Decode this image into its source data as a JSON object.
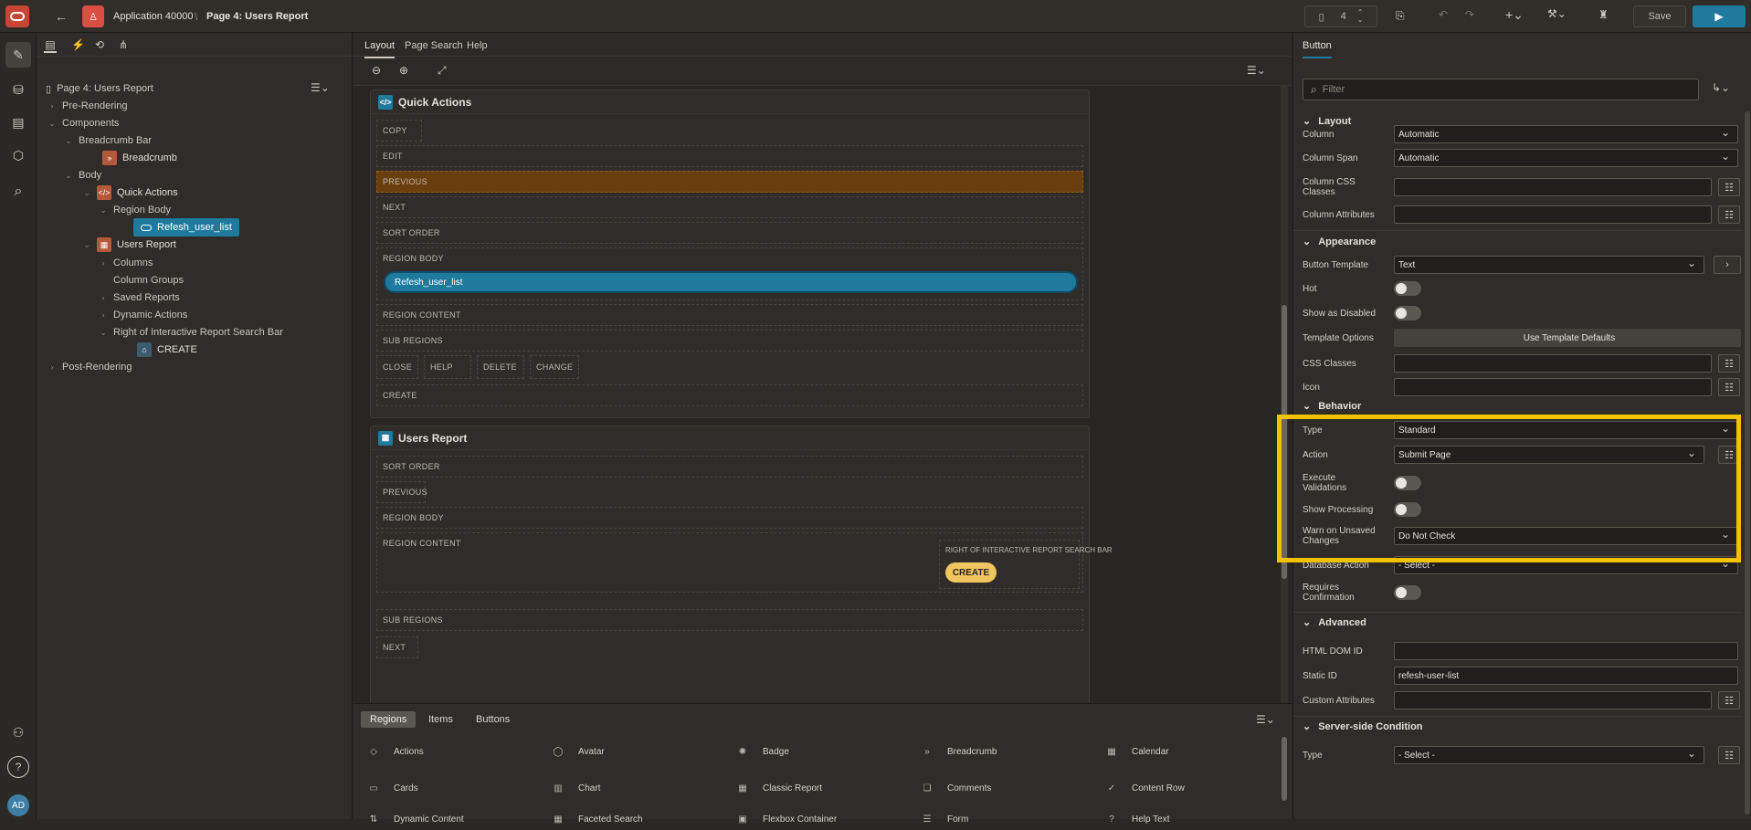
{
  "topbar": {
    "app_title": "Application 40000",
    "page_title": "Page 4: Users Report",
    "page_number": "4",
    "save_label": "Save",
    "accent": "#1f7a9e"
  },
  "left_panel": {
    "root": "Page 4: Users Report",
    "items": {
      "pre_rendering": "Pre-Rendering",
      "components": "Components",
      "breadcrumb_bar": "Breadcrumb Bar",
      "breadcrumb": "Breadcrumb",
      "body": "Body",
      "quick_actions": "Quick Actions",
      "region_body": "Region Body",
      "refesh_user_list": "Refesh_user_list",
      "users_report": "Users Report",
      "columns": "Columns",
      "column_groups": "Column Groups",
      "saved_reports": "Saved Reports",
      "dynamic_actions": "Dynamic Actions",
      "right_of_ir": "Right of Interactive Report Search Bar",
      "create": "CREATE",
      "post_rendering": "Post-Rendering"
    }
  },
  "center": {
    "tabs": [
      "Layout",
      "Page Search",
      "Help"
    ],
    "quick_actions": {
      "title": "Quick Actions",
      "slots": {
        "copy": "COPY",
        "edit": "EDIT",
        "previous": "PREVIOUS",
        "next": "NEXT",
        "sort_order": "SORT ORDER",
        "region_body": "REGION BODY",
        "button": "Refesh_user_list",
        "region_content": "REGION CONTENT",
        "sub_regions": "SUB REGIONS",
        "close": "CLOSE",
        "help": "HELP",
        "delete": "DELETE",
        "change": "CHANGE",
        "create": "CREATE"
      }
    },
    "users_report": {
      "title": "Users Report",
      "slots": {
        "sort_order": "SORT ORDER",
        "previous": "PREVIOUS",
        "region_body": "REGION BODY",
        "region_content": "REGION CONTENT",
        "right_of_ir": "RIGHT OF INTERACTIVE REPORT SEARCH BAR",
        "create_btn": "CREATE",
        "sub_regions": "SUB REGIONS",
        "next": "NEXT"
      }
    },
    "gallery": {
      "tabs": [
        "Regions",
        "Items",
        "Buttons"
      ],
      "items": [
        "Actions",
        "Avatar",
        "Badge",
        "Breadcrumb",
        "Calendar",
        "Cards",
        "Chart",
        "Classic Report",
        "Comments",
        "Content Row",
        "Dynamic Content",
        "Faceted Search",
        "Flexbox Container",
        "Form",
        "Help Text"
      ]
    }
  },
  "props": {
    "tab": "Button",
    "filter_placeholder": "Filter",
    "layout": {
      "title": "Layout",
      "column_label": "Column",
      "column_value": "Automatic",
      "span_label": "Column Span",
      "span_value": "Automatic",
      "css_label": "Column CSS Classes",
      "attr_label": "Column Attributes"
    },
    "appearance": {
      "title": "Appearance",
      "template_label": "Button Template",
      "template_value": "Text",
      "hot_label": "Hot",
      "disabled_label": "Show as Disabled",
      "options_label": "Template Options",
      "options_button": "Use Template Defaults",
      "css_label": "CSS Classes",
      "icon_label": "Icon"
    },
    "behavior": {
      "title": "Behavior",
      "type_label": "Type",
      "type_value": "Standard",
      "action_label": "Action",
      "action_value": "Submit Page",
      "validations_label": "Execute Validations",
      "processing_label": "Show Processing",
      "warn_label": "Warn on Unsaved Changes",
      "warn_value": "Do Not Check",
      "db_label": "Database Action",
      "db_value": "- Select -",
      "confirm_label": "Requires Confirmation",
      "highlight": "#f2c200"
    },
    "advanced": {
      "title": "Advanced",
      "dom_label": "HTML DOM ID",
      "static_label": "Static ID",
      "static_value": "refesh-user-list",
      "custom_label": "Custom Attributes"
    },
    "server": {
      "title": "Server-side Condition",
      "type_label": "Type",
      "type_value": "- Select -"
    }
  },
  "rail": {
    "avatar": "AD"
  }
}
